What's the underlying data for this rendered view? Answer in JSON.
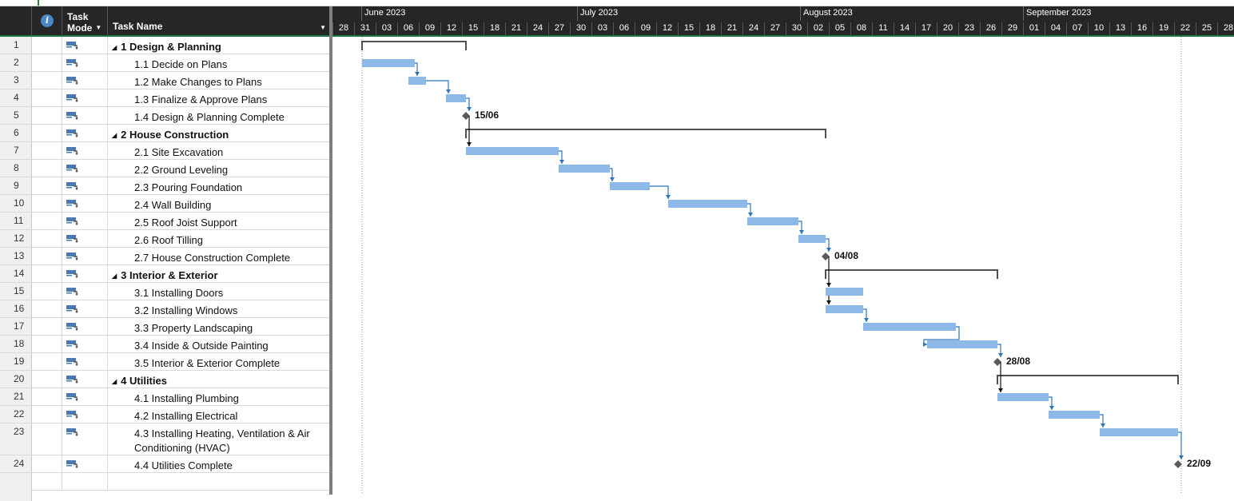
{
  "header": {
    "info_icon": "info-icon",
    "mode_line1": "Task",
    "mode_line2": "Mode",
    "task_name": "Task Name"
  },
  "tasks": [
    {
      "id": "1",
      "name": "1 Design & Planning",
      "summary": true
    },
    {
      "id": "2",
      "name": "1.1 Decide on Plans",
      "summary": false
    },
    {
      "id": "3",
      "name": "1.2 Make Changes to Plans",
      "summary": false
    },
    {
      "id": "4",
      "name": "1.3 Finalize & Approve Plans",
      "summary": false
    },
    {
      "id": "5",
      "name": "1.4 Design & Planning Complete",
      "summary": false
    },
    {
      "id": "6",
      "name": "2 House Construction",
      "summary": true
    },
    {
      "id": "7",
      "name": "2.1 Site Excavation",
      "summary": false
    },
    {
      "id": "8",
      "name": "2.2 Ground Leveling",
      "summary": false
    },
    {
      "id": "9",
      "name": "2.3 Pouring Foundation",
      "summary": false
    },
    {
      "id": "10",
      "name": "2.4 Wall Building",
      "summary": false
    },
    {
      "id": "11",
      "name": "2.5 Roof Joist Support",
      "summary": false
    },
    {
      "id": "12",
      "name": "2.6 Roof Tilling",
      "summary": false
    },
    {
      "id": "13",
      "name": "2.7 House Construction Complete",
      "summary": false
    },
    {
      "id": "14",
      "name": "3 Interior & Exterior",
      "summary": true
    },
    {
      "id": "15",
      "name": "3.1 Installing Doors",
      "summary": false
    },
    {
      "id": "16",
      "name": "3.2 Installing Windows",
      "summary": false
    },
    {
      "id": "17",
      "name": "3.3 Property Landscaping",
      "summary": false
    },
    {
      "id": "18",
      "name": "3.4 Inside & Outside Painting",
      "summary": false
    },
    {
      "id": "19",
      "name": "3.5 Interior & Exterior Complete",
      "summary": false
    },
    {
      "id": "20",
      "name": "4 Utilities",
      "summary": true
    },
    {
      "id": "21",
      "name": "4.1 Installing Plumbing",
      "summary": false
    },
    {
      "id": "22",
      "name": "4.2 Installing Electrical",
      "summary": false
    },
    {
      "id": "23",
      "name": "4.3 Installing Heating, Ventilation & Air Conditioning (HVAC)",
      "summary": false,
      "tall": true
    },
    {
      "id": "24",
      "name": "4.4 Utilities Complete",
      "summary": false
    }
  ],
  "timescale": {
    "months": [
      "June 2023",
      "July 2023",
      "August 2023",
      "September 2023"
    ],
    "days": [
      "28",
      "31",
      "03",
      "06",
      "09",
      "12",
      "15",
      "18",
      "21",
      "24",
      "27",
      "30",
      "03",
      "06",
      "09",
      "12",
      "15",
      "18",
      "21",
      "24",
      "27",
      "30",
      "02",
      "05",
      "08",
      "11",
      "14",
      "17",
      "20",
      "23",
      "26",
      "29",
      "01",
      "04",
      "07",
      "10",
      "13",
      "16",
      "19",
      "22",
      "25",
      "28"
    ]
  },
  "milestone_labels": [
    "15/06",
    "04/08",
    "28/08",
    "22/09"
  ],
  "colors": {
    "bar": "#8db9e8",
    "summary": "#505050",
    "link": "#2e75b6",
    "milestone": "#5a5a5a",
    "header_bg": "#262626",
    "header_underline": "#217346"
  }
}
